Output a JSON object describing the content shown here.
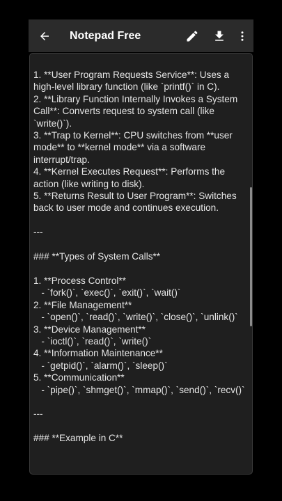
{
  "appbar": {
    "title": "Notepad Free",
    "icons": {
      "back": "arrow-back-icon",
      "edit": "pencil-icon",
      "save": "download-icon",
      "more": "more-vertical-icon"
    }
  },
  "editor": {
    "content": "1. **User Program Requests Service**: Uses a high-level library function (like `printf()` in C).\n2. **Library Function Internally Invokes a System Call**: Converts request to system call (like `write()`).\n3. **Trap to Kernel**: CPU switches from **user mode** to **kernel mode** via a software interrupt/trap.\n4. **Kernel Executes Request**: Performs the action (like writing to disk).\n5. **Returns Result to User Program**: Switches back to user mode and continues execution.\n\n---\n\n### **Types of System Calls**\n\n1. **Process Control**\n   - `fork()`, `exec()`, `exit()`, `wait()`\n2. **File Management**\n   - `open()`, `read()`, `write()`, `close()`, `unlink()`\n3. **Device Management**\n   - `ioctl()`, `read()`, `write()`\n4. **Information Maintenance**\n   - `getpid()`, `alarm()`, `sleep()`\n5. **Communication**\n   - `pipe()`, `shmget()`, `mmap()`, `send()`, `recv()`\n\n---\n\n### **Example in C**"
  },
  "colors": {
    "appbar_background": "#2b2b2b",
    "editor_background": "#1f1f1f",
    "text": "#e6e6e6",
    "scrollbar": "#8c8c8c"
  }
}
